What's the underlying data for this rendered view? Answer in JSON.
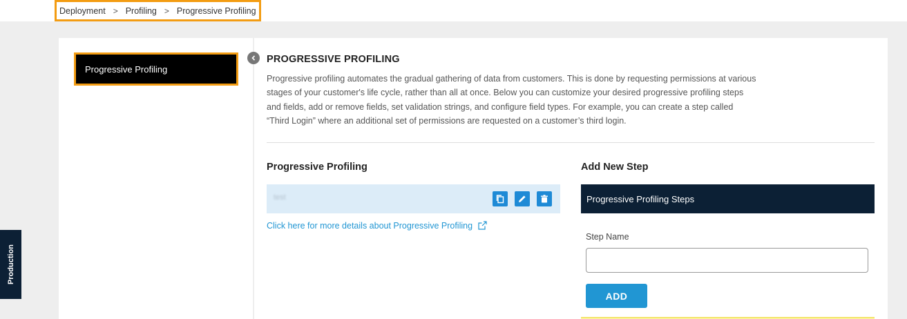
{
  "breadcrumb": {
    "items": [
      "Deployment",
      "Profiling",
      "Progressive Profiling"
    ],
    "separator": ">"
  },
  "sidebar": {
    "items": [
      {
        "label": "Progressive Profiling",
        "active": true
      }
    ],
    "collapse_icon": "chevron-left-icon"
  },
  "main": {
    "title": "PROGRESSIVE PROFILING",
    "description": "Progressive profiling automates the gradual gathering of data from customers. This is done by requesting permissions at various stages of your customer's life cycle, rather than all at once. Below you can customize your desired progressive profiling steps and fields, add or remove fields, set validation strings, and configure field types. For example, you can create a step called “Third Login” where an additional set of permissions are requested on a customer’s third login.",
    "left_section": {
      "title": "Progressive Profiling",
      "steps": [
        {
          "name": "test",
          "actions": [
            "copy-icon",
            "edit-icon",
            "delete-icon"
          ]
        }
      ],
      "details_link": "Click here for more details about Progressive Profiling"
    },
    "right_section": {
      "title": "Add New Step",
      "panel_header": "Progressive Profiling Steps",
      "field_label": "Step Name",
      "step_name_value": "",
      "add_button": "ADD"
    }
  },
  "environment_tab": "Production",
  "colors": {
    "accent": "#2196d3",
    "dark_navy": "#0c2035",
    "highlight_border": "#f39c12",
    "step_row_bg": "#dcecf8"
  }
}
